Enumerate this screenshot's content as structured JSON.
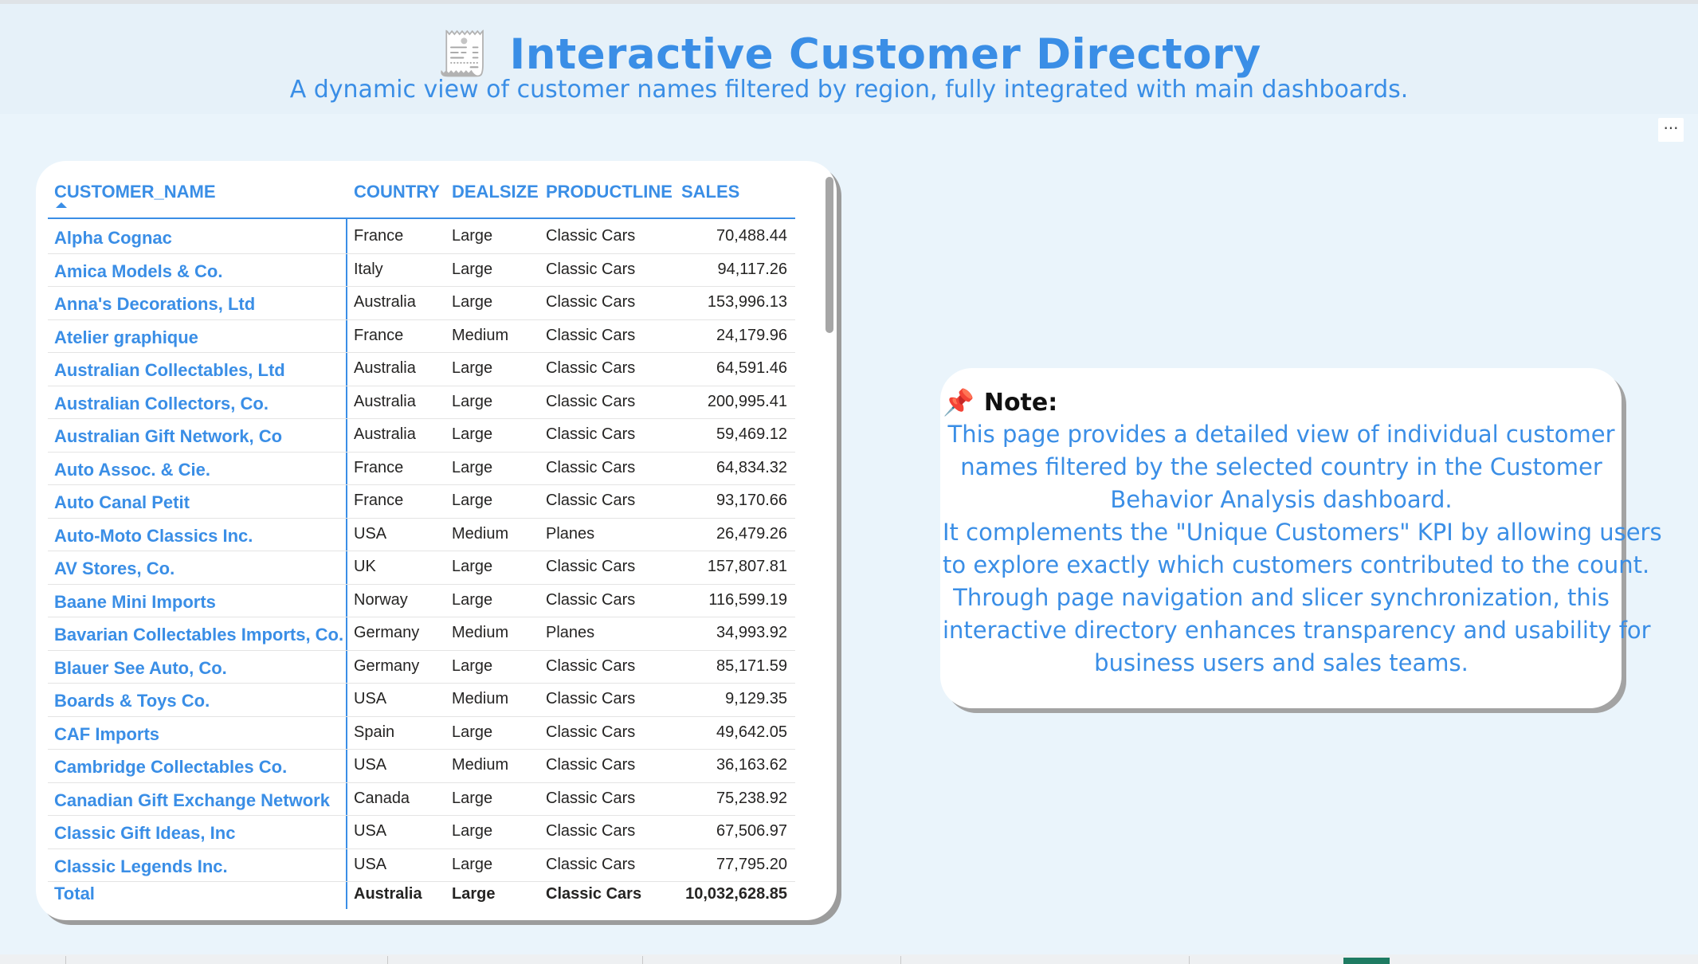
{
  "header": {
    "icon": "receipt-icon",
    "title": "Interactive Customer Directory",
    "subtitle": "A dynamic view of customer names filtered by region, fully integrated with main dashboards."
  },
  "more_options_label": "···",
  "table": {
    "columns": [
      "CUSTOMER_NAME",
      "COUNTRY",
      "DEALSIZE",
      "PRODUCTLINE",
      "SALES"
    ],
    "sorted_column": "CUSTOMER_NAME",
    "sort_direction": "ascending",
    "rows": [
      {
        "name": "Alpha Cognac",
        "country": "France",
        "deal": "Large",
        "product": "Classic Cars",
        "sales": "70,488.44"
      },
      {
        "name": "Amica Models & Co.",
        "country": "Italy",
        "deal": "Large",
        "product": "Classic Cars",
        "sales": "94,117.26"
      },
      {
        "name": "Anna's Decorations, Ltd",
        "country": "Australia",
        "deal": "Large",
        "product": "Classic Cars",
        "sales": "153,996.13"
      },
      {
        "name": "Atelier graphique",
        "country": "France",
        "deal": "Medium",
        "product": "Classic Cars",
        "sales": "24,179.96"
      },
      {
        "name": "Australian Collectables, Ltd",
        "country": "Australia",
        "deal": "Large",
        "product": "Classic Cars",
        "sales": "64,591.46"
      },
      {
        "name": "Australian Collectors, Co.",
        "country": "Australia",
        "deal": "Large",
        "product": "Classic Cars",
        "sales": "200,995.41"
      },
      {
        "name": "Australian Gift Network, Co",
        "country": "Australia",
        "deal": "Large",
        "product": "Classic Cars",
        "sales": "59,469.12"
      },
      {
        "name": "Auto Assoc. & Cie.",
        "country": "France",
        "deal": "Large",
        "product": "Classic Cars",
        "sales": "64,834.32"
      },
      {
        "name": "Auto Canal Petit",
        "country": "France",
        "deal": "Large",
        "product": "Classic Cars",
        "sales": "93,170.66"
      },
      {
        "name": "Auto-Moto Classics Inc.",
        "country": "USA",
        "deal": "Medium",
        "product": "Planes",
        "sales": "26,479.26"
      },
      {
        "name": "AV Stores, Co.",
        "country": "UK",
        "deal": "Large",
        "product": "Classic Cars",
        "sales": "157,807.81"
      },
      {
        "name": "Baane Mini Imports",
        "country": "Norway",
        "deal": "Large",
        "product": "Classic Cars",
        "sales": "116,599.19"
      },
      {
        "name": "Bavarian Collectables Imports, Co.",
        "country": "Germany",
        "deal": "Medium",
        "product": "Planes",
        "sales": "34,993.92"
      },
      {
        "name": "Blauer See Auto, Co.",
        "country": "Germany",
        "deal": "Large",
        "product": "Classic Cars",
        "sales": "85,171.59"
      },
      {
        "name": "Boards & Toys Co.",
        "country": "USA",
        "deal": "Medium",
        "product": "Classic Cars",
        "sales": "9,129.35"
      },
      {
        "name": "CAF Imports",
        "country": "Spain",
        "deal": "Large",
        "product": "Classic Cars",
        "sales": "49,642.05"
      },
      {
        "name": "Cambridge Collectables Co.",
        "country": "USA",
        "deal": "Medium",
        "product": "Classic Cars",
        "sales": "36,163.62"
      },
      {
        "name": "Canadian Gift Exchange Network",
        "country": "Canada",
        "deal": "Large",
        "product": "Classic Cars",
        "sales": "75,238.92"
      },
      {
        "name": "Classic Gift Ideas, Inc",
        "country": "USA",
        "deal": "Large",
        "product": "Classic Cars",
        "sales": "67,506.97"
      },
      {
        "name": "Classic Legends Inc.",
        "country": "USA",
        "deal": "Large",
        "product": "Classic Cars",
        "sales": "77,795.20"
      }
    ],
    "total": {
      "name": "Total",
      "country": "Australia",
      "deal": "Large",
      "product": "Classic Cars",
      "sales": "10,032,628.85"
    }
  },
  "note": {
    "icon": "pushpin-icon",
    "title": "Note:",
    "lines": [
      "This page provides a detailed view of individual customer",
      "names filtered by the selected country in the Customer",
      "Behavior Analysis dashboard.",
      "It complements the \"Unique Customers\" KPI by allowing users",
      "to explore exactly which customers contributed to the count.",
      "Through page navigation and slicer synchronization, this",
      "interactive directory enhances transparency and usability for",
      "business users and sales teams."
    ]
  },
  "colors": {
    "accent": "#3a8ee6",
    "background": "#eaf4fb",
    "card": "#ffffff",
    "active_tab": "#1e7b62"
  }
}
